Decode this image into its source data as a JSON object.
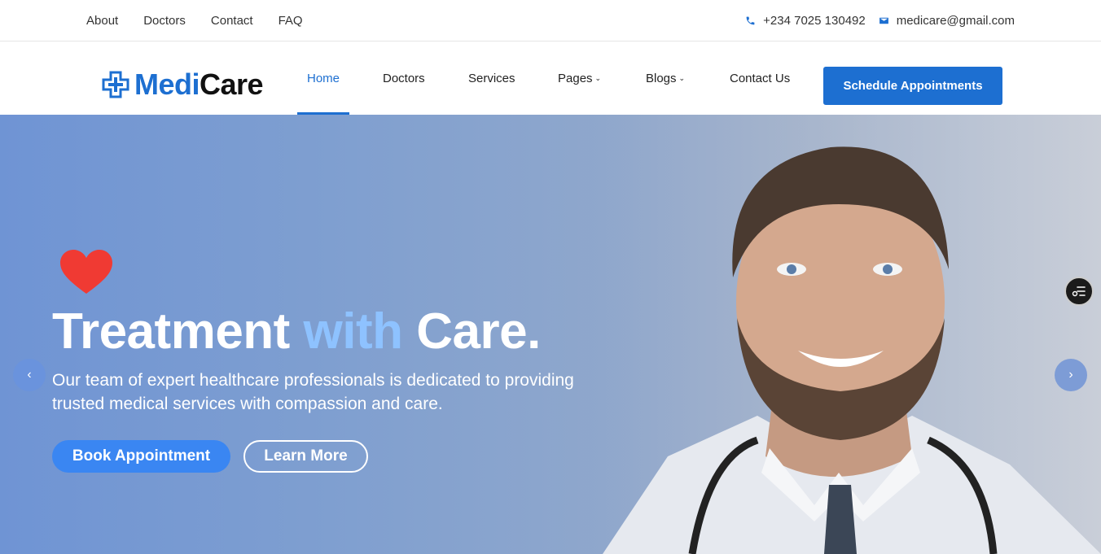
{
  "topbar": {
    "links": [
      "About",
      "Doctors",
      "Contact",
      "FAQ"
    ],
    "phone": "+234 7025 130492",
    "email": "medicare@gmail.com"
  },
  "logo": {
    "part1": "Medi",
    "part2": "Care"
  },
  "nav": {
    "items": [
      {
        "label": "Home",
        "active": true
      },
      {
        "label": "Doctors"
      },
      {
        "label": "Services"
      },
      {
        "label": "Pages",
        "dropdown": true
      },
      {
        "label": "Blogs",
        "dropdown": true
      },
      {
        "label": "Contact Us"
      }
    ],
    "cta": "Schedule Appointments"
  },
  "hero": {
    "title_part1": "Treatment ",
    "title_accent": "with",
    "title_part2": " Care.",
    "subtitle": "Our team of expert healthcare professionals is dedicated to providing trusted medical services with compassion and care.",
    "primary_button": "Book Appointment",
    "secondary_button": "Learn More",
    "prev_icon": "chevron-left-icon",
    "next_icon": "chevron-right-icon"
  },
  "colors": {
    "brand": "#1d6fd1",
    "accent_text": "#8ec2ff",
    "heart": "#f03a33",
    "primary_button": "#3a86f2"
  }
}
